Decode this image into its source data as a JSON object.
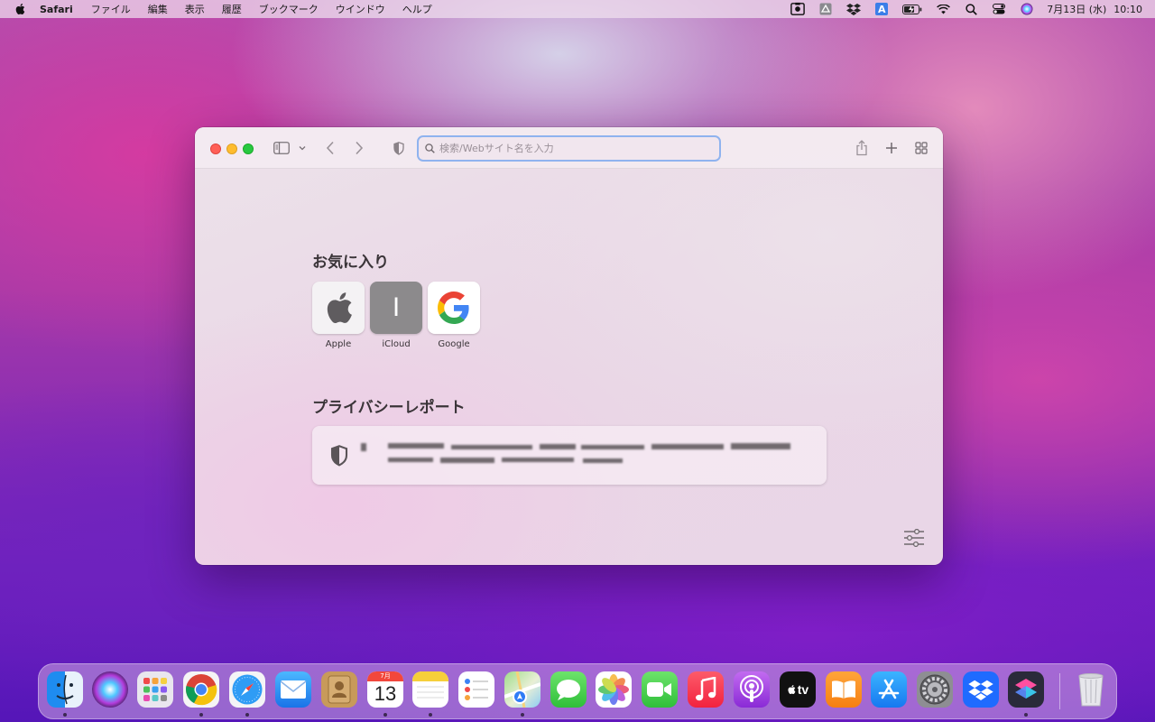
{
  "menubar": {
    "app_name": "Safari",
    "menus": [
      "ファイル",
      "編集",
      "表示",
      "履歴",
      "ブックマーク",
      "ウインドウ",
      "ヘルプ"
    ],
    "status_icons": [
      "screenshot-icon",
      "drive-icon",
      "dropbox-icon",
      "input-source-icon",
      "battery-icon",
      "wifi-icon",
      "spotlight-icon",
      "control-center-icon",
      "siri-icon"
    ],
    "input_source_label": "A",
    "date": "7月13日 (水)",
    "time": "10:10"
  },
  "window": {
    "address_placeholder": "検索/Webサイト名を入力",
    "favorites_title": "お気に入り",
    "favorites": [
      {
        "label": "Apple",
        "icon": "apple-logo-icon"
      },
      {
        "label": "iCloud",
        "icon": "letter-tile",
        "letter": "I"
      },
      {
        "label": "Google",
        "icon": "google-logo-icon"
      }
    ],
    "privacy_title": "プライバシーレポート"
  },
  "dock": {
    "apps": [
      {
        "name": "finder",
        "running": true
      },
      {
        "name": "siri",
        "running": false
      },
      {
        "name": "launchpad",
        "running": false
      },
      {
        "name": "chrome",
        "running": true
      },
      {
        "name": "safari",
        "running": true
      },
      {
        "name": "mail",
        "running": false
      },
      {
        "name": "contacts",
        "running": false
      },
      {
        "name": "calendar",
        "running": true,
        "month": "7月",
        "day": "13"
      },
      {
        "name": "notes",
        "running": true
      },
      {
        "name": "reminders",
        "running": false
      },
      {
        "name": "maps",
        "running": true
      },
      {
        "name": "messages",
        "running": false
      },
      {
        "name": "photos",
        "running": false
      },
      {
        "name": "facetime",
        "running": false
      },
      {
        "name": "music",
        "running": false
      },
      {
        "name": "podcasts",
        "running": false
      },
      {
        "name": "apple-tv",
        "running": false,
        "label": "tv"
      },
      {
        "name": "books",
        "running": false
      },
      {
        "name": "app-store",
        "running": false
      },
      {
        "name": "system-preferences",
        "running": false
      },
      {
        "name": "dropbox",
        "running": false
      },
      {
        "name": "shortcuts",
        "running": true
      },
      {
        "name": "trash",
        "running": false
      }
    ]
  }
}
